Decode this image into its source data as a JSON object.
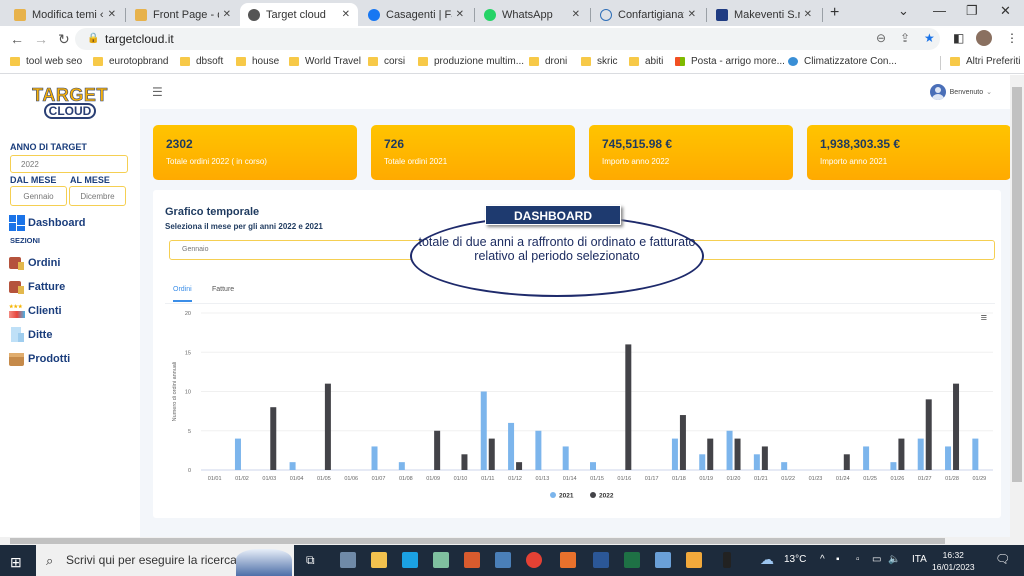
{
  "browser": {
    "tabs": [
      {
        "label": "Modifica temi ‹ d",
        "icon": "wordpress-icon",
        "active": false
      },
      {
        "label": "Front Page - dbsc",
        "icon": "wordpress-icon",
        "active": false
      },
      {
        "label": "Target cloud",
        "icon": "globe-icon",
        "active": true
      },
      {
        "label": "Casagenti | Faceb",
        "icon": "facebook-icon",
        "active": false
      },
      {
        "label": "WhatsApp",
        "icon": "whatsapp-icon",
        "active": false
      },
      {
        "label": "Confartigianato A",
        "icon": "confartigianato-icon",
        "active": false
      },
      {
        "label": "Makeventi S.r.l. (",
        "icon": "chart-icon",
        "active": false
      }
    ],
    "url": "targetcloud.it",
    "bookmarks": [
      {
        "label": "tool web seo"
      },
      {
        "label": "eurotopbrand"
      },
      {
        "label": "dbsoft"
      },
      {
        "label": "house"
      },
      {
        "label": "World Travel"
      },
      {
        "label": "corsi"
      },
      {
        "label": "produzione multim..."
      },
      {
        "label": "droni"
      },
      {
        "label": "skric"
      },
      {
        "label": "abiti"
      },
      {
        "label": "Posta - arrigo more..."
      },
      {
        "label": "Climatizzatore Con..."
      }
    ],
    "other_bookmarks": "Altri Preferiti"
  },
  "sidebar": {
    "logo_top": "TARGET",
    "logo_bottom": "CLOUD",
    "year_label": "ANNO DI TARGET",
    "year_value": "2022",
    "from_label": "DAL MESE",
    "to_label": "AL MESE",
    "from_value": "Gennaio",
    "to_value": "Dicembre",
    "dashboard_label": "Dashboard",
    "sections_label": "SEZIONI",
    "items": [
      {
        "label": "Ordini",
        "icon": "orders-box-icon"
      },
      {
        "label": "Fatture",
        "icon": "invoices-box-icon"
      },
      {
        "label": "Clienti",
        "icon": "clients-icon"
      },
      {
        "label": "Ditte",
        "icon": "companies-icon"
      },
      {
        "label": "Prodotti",
        "icon": "products-box-icon"
      }
    ]
  },
  "header": {
    "user_label": "Benvenuto"
  },
  "cards": [
    {
      "value": "2302",
      "label": "Totale ordini 2022 ( in corso)"
    },
    {
      "value": "726",
      "label": "Totale ordini 2021"
    },
    {
      "value": "745,515.98 €",
      "label": "Importo anno 2022"
    },
    {
      "value": "1,938,303.35 €",
      "label": "Importo anno 2021"
    }
  ],
  "panel": {
    "title": "Grafico temporale",
    "subtitle": "Seleziona il mese per gli anni 2022 e 2021",
    "month_select": "Gennaio",
    "tabs": [
      {
        "label": "Ordini",
        "active": true
      },
      {
        "label": "Fatture",
        "active": false
      }
    ]
  },
  "callout": {
    "header": "DASHBOARD",
    "text": "totale di due anni a raffronto di ordinato e fatturato relativo al periodo selezionato"
  },
  "chart_data": {
    "type": "bar",
    "title": "",
    "xlabel": "",
    "ylabel": "Numero di ordini annuali",
    "ylim": [
      0,
      20
    ],
    "yticks": [
      0,
      5,
      10,
      15,
      20
    ],
    "grid": true,
    "legend": "bottom-center",
    "categories": [
      "01/01",
      "01/02",
      "01/03",
      "01/04",
      "01/05",
      "01/06",
      "01/07",
      "01/08",
      "01/09",
      "01/10",
      "01/11",
      "01/12",
      "01/13",
      "01/14",
      "01/15",
      "01/16",
      "01/17",
      "01/18",
      "01/19",
      "01/20",
      "01/21",
      "01/22",
      "01/23",
      "01/24",
      "01/25",
      "01/26",
      "01/27",
      "01/28",
      "01/29"
    ],
    "series": [
      {
        "name": "2021",
        "color": "#7cb5ec",
        "values": [
          0,
          4,
          0,
          1,
          0,
          0,
          3,
          1,
          0,
          0,
          10,
          6,
          5,
          3,
          1,
          0,
          0,
          4,
          2,
          5,
          2,
          1,
          0,
          0,
          3,
          1,
          4,
          3,
          4
        ]
      },
      {
        "name": "2022",
        "color": "#434348",
        "values": [
          0,
          0,
          8,
          0,
          11,
          0,
          0,
          0,
          5,
          2,
          4,
          1,
          0,
          0,
          0,
          16,
          0,
          7,
          4,
          4,
          3,
          0,
          0,
          2,
          0,
          4,
          9,
          11,
          0
        ]
      }
    ]
  },
  "taskbar": {
    "search_placeholder": "Scrivi qui per eseguire la ricerca",
    "temperature": "13°C",
    "language": "ITA",
    "time": "16:32",
    "date": "16/01/2023"
  }
}
